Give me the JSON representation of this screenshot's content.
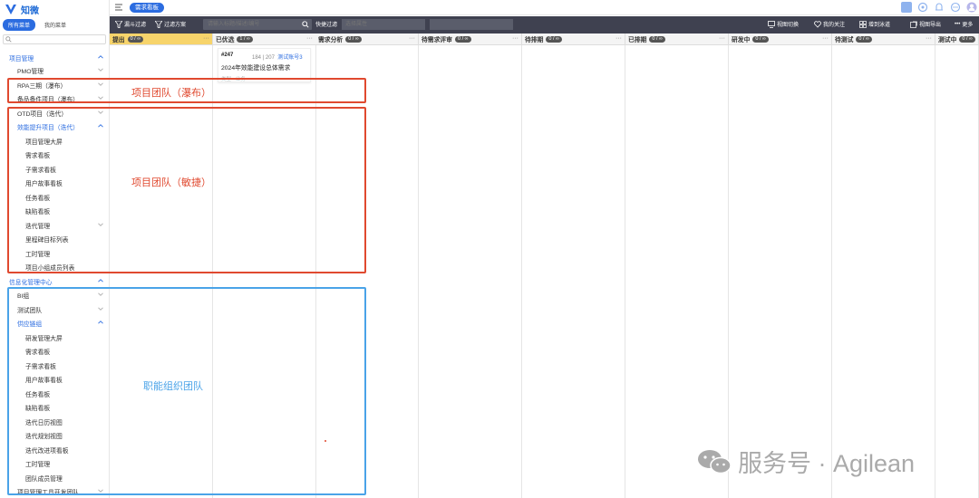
{
  "app": {
    "name": "知微"
  },
  "sidebar": {
    "tabs": [
      {
        "label": "所有菜单"
      },
      {
        "label": "我的菜单"
      }
    ],
    "search_placeholder": "",
    "items": [
      {
        "label": "项目管理",
        "level": 0,
        "blue": true,
        "chev": "up"
      },
      {
        "label": "PMO管理",
        "level": 1,
        "blue": false,
        "chev": "down"
      },
      {
        "label": "RPA三期（瀑布）",
        "level": 1,
        "blue": false,
        "chev": "down"
      },
      {
        "label": "备品备件项目（瀑布）",
        "level": 1,
        "blue": false,
        "chev": "down"
      },
      {
        "label": "OTD项目（迭代）",
        "level": 1,
        "blue": false,
        "chev": "down"
      },
      {
        "label": "效能提升项目（迭代）",
        "level": 1,
        "blue": true,
        "chev": "up"
      },
      {
        "label": "项目管理大屏",
        "level": 2,
        "blue": false,
        "chev": ""
      },
      {
        "label": "需求看板",
        "level": 2,
        "blue": false,
        "chev": ""
      },
      {
        "label": "子需求看板",
        "level": 2,
        "blue": false,
        "chev": ""
      },
      {
        "label": "用户故事看板",
        "level": 2,
        "blue": false,
        "chev": ""
      },
      {
        "label": "任务看板",
        "level": 2,
        "blue": false,
        "chev": ""
      },
      {
        "label": "缺陷看板",
        "level": 2,
        "blue": false,
        "chev": ""
      },
      {
        "label": "迭代管理",
        "level": 2,
        "blue": false,
        "chev": "down"
      },
      {
        "label": "里程碑目标列表",
        "level": 2,
        "blue": false,
        "chev": ""
      },
      {
        "label": "工时管理",
        "level": 2,
        "blue": false,
        "chev": ""
      },
      {
        "label": "项目小组成员列表",
        "level": 2,
        "blue": false,
        "chev": ""
      },
      {
        "label": "信息化管理中心",
        "level": 0,
        "blue": true,
        "chev": "up"
      },
      {
        "label": "BI组",
        "level": 1,
        "blue": false,
        "chev": "down"
      },
      {
        "label": "测试团队",
        "level": 1,
        "blue": false,
        "chev": "down"
      },
      {
        "label": "供应链组",
        "level": 1,
        "blue": true,
        "chev": "up"
      },
      {
        "label": "研发管理大屏",
        "level": 2,
        "blue": false,
        "chev": ""
      },
      {
        "label": "需求看板",
        "level": 2,
        "blue": false,
        "chev": ""
      },
      {
        "label": "子需求看板",
        "level": 2,
        "blue": false,
        "chev": ""
      },
      {
        "label": "用户故事看板",
        "level": 2,
        "blue": false,
        "chev": ""
      },
      {
        "label": "任务看板",
        "level": 2,
        "blue": false,
        "chev": ""
      },
      {
        "label": "缺陷看板",
        "level": 2,
        "blue": false,
        "chev": ""
      },
      {
        "label": "迭代日历视图",
        "level": 2,
        "blue": false,
        "chev": ""
      },
      {
        "label": "迭代规划视图",
        "level": 2,
        "blue": false,
        "chev": ""
      },
      {
        "label": "迭代改进项看板",
        "level": 2,
        "blue": false,
        "chev": ""
      },
      {
        "label": "工时管理",
        "level": 2,
        "blue": false,
        "chev": ""
      },
      {
        "label": "团队成员管理",
        "level": 2,
        "blue": false,
        "chev": ""
      },
      {
        "label": "项目管理工具开发团队",
        "level": 1,
        "blue": false,
        "chev": "down"
      }
    ]
  },
  "topbar": {
    "page_tab": "需求看板"
  },
  "toolbar": {
    "funnel_filter": "漏斗过滤",
    "filter_plan": "过滤方案",
    "search_placeholder": "请输入标题/描述/编号",
    "quick_filter": "快捷过滤",
    "attr_placeholder": "选择属性",
    "view_switch": "视图切换",
    "my_follow": "我的关注",
    "add_swimlane": "增到泳道",
    "view_export": "视图导出",
    "more": "更多"
  },
  "board": {
    "columns": [
      {
        "name": "提出",
        "count": "0 / ∞"
      },
      {
        "name": "已优选",
        "count": "1 / ∞"
      },
      {
        "name": "需求分析",
        "count": "0 / ∞"
      },
      {
        "name": "待需求评审",
        "count": "0 / ∞"
      },
      {
        "name": "待排期",
        "count": "0 / ∞"
      },
      {
        "name": "已排期",
        "count": "0 / ∞"
      },
      {
        "name": "研发中",
        "count": "0 / ∞"
      },
      {
        "name": "待测试",
        "count": "0 / ∞"
      },
      {
        "name": "测试中",
        "count": "0 / ∞"
      }
    ],
    "card": {
      "id": "#247",
      "meta": "184 | 207",
      "owner": "测试账号3",
      "title": "2024年效能建设总体需求",
      "foot": "类型 · 业务"
    }
  },
  "annotations": {
    "waterfall": "项目团队（瀑布）",
    "agile": "项目团队（敏捷）",
    "functional": "职能组织团队"
  },
  "watermark": {
    "text": "服务号 · Agilean"
  },
  "colors": {
    "primary": "#2b6ce0",
    "toolbar": "#3f4150",
    "first_column": "#f7d46b",
    "red": "#e0492f",
    "blue": "#4aa3e8"
  }
}
